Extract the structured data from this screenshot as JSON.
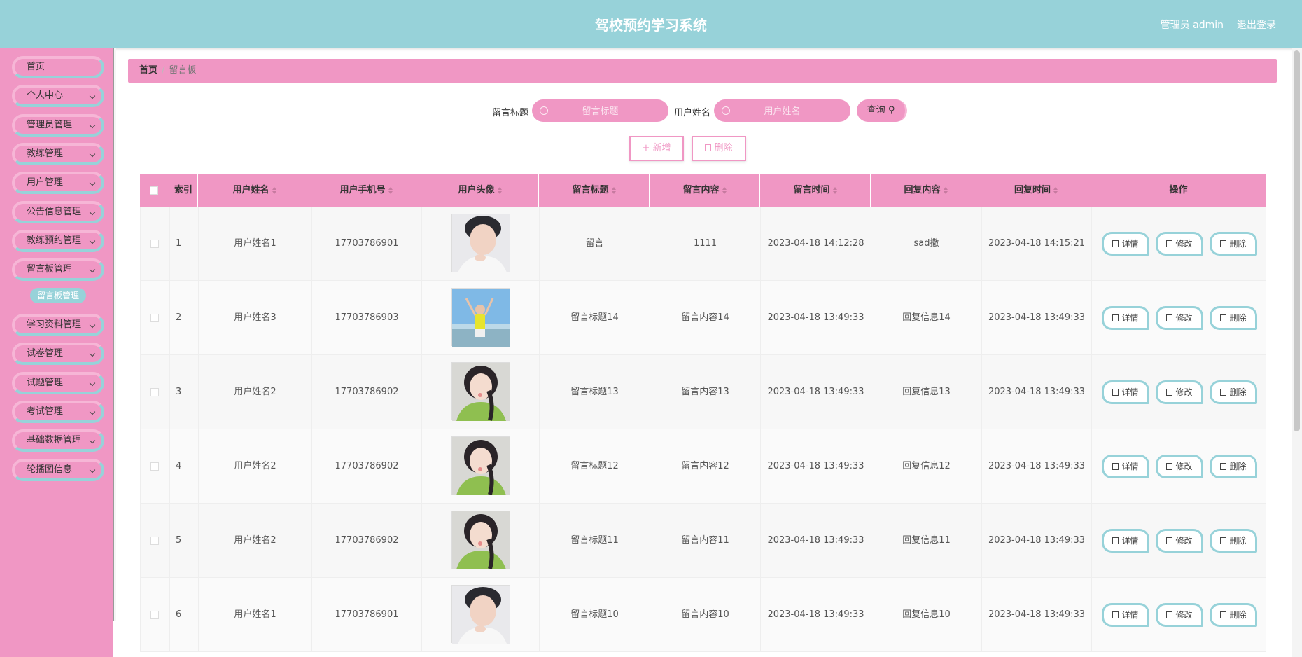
{
  "header": {
    "title": "驾校预约学习系统",
    "user": "管理员 admin",
    "logout": "退出登录"
  },
  "sidebar": {
    "items": [
      {
        "label": "首页",
        "arrow": false
      },
      {
        "label": "个人中心",
        "arrow": true
      },
      {
        "label": "管理员管理",
        "arrow": true
      },
      {
        "label": "教练管理",
        "arrow": true
      },
      {
        "label": "用户管理",
        "arrow": true
      },
      {
        "label": "公告信息管理",
        "arrow": true
      },
      {
        "label": "教练预约管理",
        "arrow": true
      },
      {
        "label": "留言板管理",
        "arrow": true
      },
      {
        "label": "学习资料管理",
        "arrow": true
      },
      {
        "label": "试卷管理",
        "arrow": true
      },
      {
        "label": "试题管理",
        "arrow": true
      },
      {
        "label": "考试管理",
        "arrow": true
      },
      {
        "label": "基础数据管理",
        "arrow": true
      },
      {
        "label": "轮播图信息",
        "arrow": true
      }
    ],
    "active_sub": "留言板管理"
  },
  "breadcrumb": {
    "home": "首页",
    "sep": "/",
    "current": "留言板"
  },
  "search": {
    "title_label": "留言标题",
    "title_placeholder": "留言标题",
    "name_label": "用户姓名",
    "name_placeholder": "用户姓名",
    "query": "查询"
  },
  "actions": {
    "add": "+ 新增",
    "delete": "删除"
  },
  "table": {
    "headers": [
      "索引",
      "用户姓名",
      "用户手机号",
      "用户头像",
      "留言标题",
      "留言内容",
      "留言时间",
      "回复内容",
      "回复时间",
      "操作"
    ],
    "ops": [
      "详情",
      "修改",
      "删除"
    ],
    "rows": [
      {
        "idx": "1",
        "name": "用户姓名1",
        "phone": "17703786901",
        "avatar": "male",
        "title": "留言",
        "content": "1111",
        "time": "2023-04-18 14:12:28",
        "reply": "sad撒",
        "reply_time": "2023-04-18 14:15:21"
      },
      {
        "idx": "2",
        "name": "用户姓名3",
        "phone": "17703786903",
        "avatar": "beach",
        "title": "留言标题14",
        "content": "留言内容14",
        "time": "2023-04-18 13:49:33",
        "reply": "回复信息14",
        "reply_time": "2023-04-18 13:49:33"
      },
      {
        "idx": "3",
        "name": "用户姓名2",
        "phone": "17703786902",
        "avatar": "green",
        "title": "留言标题13",
        "content": "留言内容13",
        "time": "2023-04-18 13:49:33",
        "reply": "回复信息13",
        "reply_time": "2023-04-18 13:49:33"
      },
      {
        "idx": "4",
        "name": "用户姓名2",
        "phone": "17703786902",
        "avatar": "green",
        "title": "留言标题12",
        "content": "留言内容12",
        "time": "2023-04-18 13:49:33",
        "reply": "回复信息12",
        "reply_time": "2023-04-18 13:49:33"
      },
      {
        "idx": "5",
        "name": "用户姓名2",
        "phone": "17703786902",
        "avatar": "green",
        "title": "留言标题11",
        "content": "留言内容11",
        "time": "2023-04-18 13:49:33",
        "reply": "回复信息11",
        "reply_time": "2023-04-18 13:49:33"
      },
      {
        "idx": "6",
        "name": "用户姓名1",
        "phone": "17703786901",
        "avatar": "male",
        "title": "留言标题10",
        "content": "留言内容10",
        "time": "2023-04-18 13:49:33",
        "reply": "回复信息10",
        "reply_time": "2023-04-18 13:49:33"
      }
    ]
  },
  "colors": {
    "pink": "#f097c4",
    "teal": "#97d2d9"
  }
}
